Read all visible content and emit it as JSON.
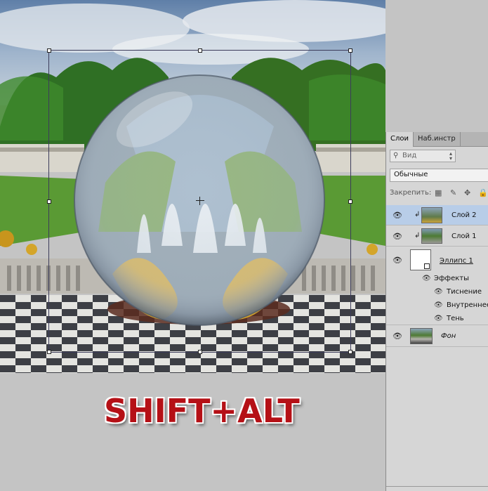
{
  "canvas": {
    "caption": "SHIFT+ALT"
  },
  "layers_panel": {
    "tabs": [
      {
        "label": "Слои",
        "active": true
      },
      {
        "label": "Наб.инстр",
        "active": false
      }
    ],
    "search": {
      "icon": "search-icon",
      "value": "Вид"
    },
    "blend_mode": "Обычные",
    "lock_label": "Закрепить:",
    "lock_icons": [
      "checkerboard-icon",
      "brush-icon",
      "move-icon",
      "lock-icon"
    ],
    "layers": [
      {
        "name": "Слой 2",
        "selected": true,
        "clipped": true,
        "visible": true
      },
      {
        "name": "Слой 1",
        "selected": false,
        "clipped": true,
        "visible": true
      },
      {
        "name": "Эллипс 1",
        "selected": false,
        "clipped": false,
        "visible": true,
        "effects_label": "Эффекты",
        "effects": [
          "Тиснение",
          "Внутреннее с",
          "Тень"
        ]
      },
      {
        "name": "Фон",
        "selected": false,
        "clipped": false,
        "visible": true
      }
    ]
  },
  "colors": {
    "caption_red": "#b51016",
    "selected_layer": "#b8cde8",
    "panel_bg": "#d6d6d6",
    "workspace_bg": "#c4c4c4"
  }
}
